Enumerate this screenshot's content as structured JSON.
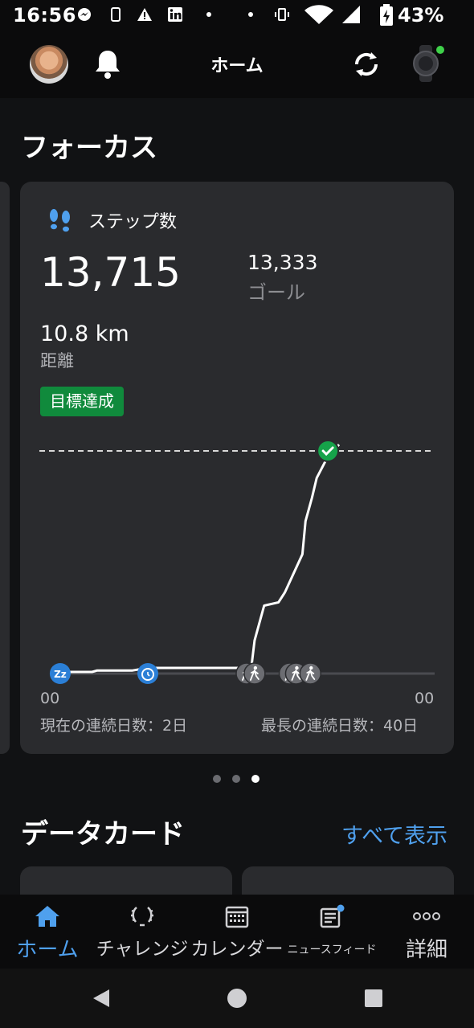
{
  "status_bar": {
    "time": "16:56",
    "battery": "43%",
    "icons": [
      "messenger-icon",
      "phone-icon",
      "warning-icon",
      "linkedin-icon",
      "dot-icon",
      "dot-icon",
      "vibrate-icon",
      "wifi-icon",
      "signal-icon",
      "battery-charging-icon"
    ]
  },
  "header": {
    "title": "ホーム"
  },
  "focus": {
    "title": "フォーカス",
    "steps_card": {
      "label": "ステップ数",
      "steps": "13,715",
      "goal_value": "13,333",
      "goal_label": "ゴール",
      "distance_value": "10.8 km",
      "distance_label": "距離",
      "badge": "目標達成",
      "axis_start": "00",
      "axis_end": "00",
      "streak_current": "現在の連続日数：2日",
      "streak_longest": "最長の連続日数：40日"
    },
    "pager": {
      "count": 3,
      "active": 3
    }
  },
  "datacards": {
    "title": "データカード",
    "show_all": "すべて表示"
  },
  "bottom_nav": [
    {
      "label": "ホーム",
      "icon": "home-icon",
      "active": true
    },
    {
      "label": "チャレンジ",
      "icon": "laurel-icon",
      "active": false
    },
    {
      "label": "カレンダー",
      "icon": "calendar-icon",
      "active": false
    },
    {
      "label": "ニュースフィード",
      "icon": "newsfeed-icon",
      "active": false
    },
    {
      "label": "詳細",
      "icon": "more-icon",
      "active": false
    }
  ],
  "colors": {
    "accent": "#4fa0ee",
    "success": "#108a3c",
    "card": "#2a2b2e",
    "background": "#111214"
  },
  "chart_data": {
    "type": "line",
    "x_range": [
      "00:00",
      "24:00"
    ],
    "xlabel": "",
    "ylabel": "",
    "goal": 13333,
    "ylim": [
      0,
      13333
    ],
    "x": [
      0.5,
      2.5,
      2.8,
      5,
      6,
      12.2,
      12.5,
      12.7,
      13.3,
      14.2,
      14.6,
      15.7,
      15.9,
      16.3,
      16.6,
      17.3,
      18.0
    ],
    "cumulative_steps": [
      0,
      0,
      80,
      80,
      240,
      240,
      300,
      1900,
      4000,
      4200,
      4800,
      7100,
      9100,
      10500,
      11700,
      13000,
      13715
    ],
    "markers": [
      {
        "x": 0.5,
        "type": "sleep",
        "icon": "sleep-icon"
      },
      {
        "x": 6.0,
        "type": "timer",
        "icon": "stopwatch-icon"
      },
      {
        "x": 12.2,
        "type": "activity",
        "icon": "walk-icon"
      },
      {
        "x": 12.7,
        "type": "walk",
        "icon": "walk-icon"
      },
      {
        "x": 14.9,
        "type": "walk",
        "icon": "walk-icon"
      },
      {
        "x": 15.3,
        "type": "walk",
        "icon": "walk-icon"
      },
      {
        "x": 16.2,
        "type": "walk",
        "icon": "walk-icon"
      },
      {
        "x": 17.3,
        "type": "goal",
        "icon": "check-icon"
      }
    ]
  }
}
